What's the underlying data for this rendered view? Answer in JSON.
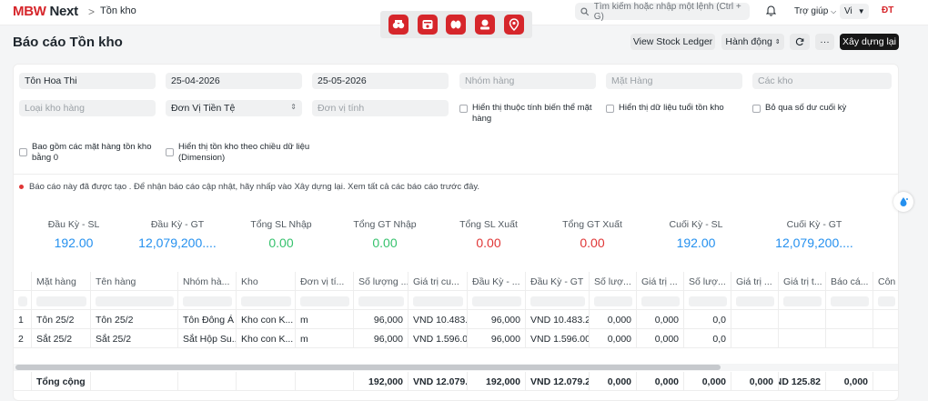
{
  "header": {
    "logo_a": "MBW",
    "logo_b": " Next",
    "breadcrumb_sep": ">",
    "breadcrumb": "Tồn kho",
    "search_placeholder": "Tìm kiếm hoặc nhập một lệnh (Ctrl + G)",
    "help": "Trợ giúp",
    "lang": "Vi",
    "avatar": "ĐT"
  },
  "page": {
    "title": "Báo cáo Tồn kho",
    "view_ledger": "View Stock Ledger",
    "actions": "Hành động",
    "more": "···",
    "rebuild": "Xây dựng lại"
  },
  "filters": {
    "company": "Tôn Hoa Thi",
    "from_date": "25-04-2026",
    "to_date": "25-05-2026",
    "item_group_ph": "Nhóm hàng",
    "item_ph": "Mặt Hàng",
    "warehouse_ph": "Các kho",
    "warehouse_type_ph": "Loại kho hàng",
    "currency": "Đơn Vị Tiền Tệ",
    "uom_ph": "Đơn vị tính",
    "chk_variant": "Hiển thị thuộc tính biến thể mặt hàng",
    "chk_aging": "Hiển thị dữ liệu tuổi tồn kho",
    "chk_skip": "Bỏ qua số dư cuối kỳ",
    "chk_zero": "Bao gồm các mặt hàng tồn kho bằng 0",
    "chk_dimension": "Hiển thị tồn kho theo chiều dữ liệu (Dimension)"
  },
  "notice": "Báo cáo này đã được tạo . Để nhận báo cáo cập nhật, hãy nhấp vào Xây dựng lại. Xem tất cả các báo cáo trước đây.",
  "summary": [
    {
      "label": "Đầu Kỳ - SL",
      "value": "192.00",
      "color": "#2490ef"
    },
    {
      "label": "Đầu Kỳ - GT",
      "value": "12,079,200....",
      "color": "#2490ef"
    },
    {
      "label": "Tổng SL Nhập",
      "value": "0.00",
      "color": "#36c26d"
    },
    {
      "label": "Tổng GT Nhập",
      "value": "0.00",
      "color": "#36c26d"
    },
    {
      "label": "Tổng SL Xuất",
      "value": "0.00",
      "color": "#e03636"
    },
    {
      "label": "Tổng GT Xuất",
      "value": "0.00",
      "color": "#e03636"
    },
    {
      "label": "Cuối Kỳ - SL",
      "value": "192.00",
      "color": "#2490ef"
    },
    {
      "label": "Cuối Kỳ - GT",
      "value": "12,079,200....",
      "color": "#2490ef"
    }
  ],
  "table": {
    "columns": [
      "Mặt hàng",
      "Tên hàng",
      "Nhóm hà...",
      "Kho",
      "Đơn vị tí...",
      "Số lượng ...",
      "Giá trị cu...",
      "Đầu Kỳ - ...",
      "Đầu Kỳ - GT",
      "Số lượ...",
      "Giá trị ...",
      "Số lượ...",
      "Giá trị ...",
      "Giá trị t...",
      "Báo cá...",
      "Côn"
    ],
    "rows": [
      [
        "1",
        "Tôn 25/2",
        "Tôn 25/2",
        "Tôn Đông Á",
        "Kho con K...",
        "m",
        "96,000",
        "VND 10.483.2",
        "96,000",
        "VND 10.483.20",
        "0,000",
        "0,000",
        "0,0",
        "",
        "",
        "",
        ""
      ],
      [
        "2",
        "Sắt 25/2",
        "Sắt 25/2",
        "Sắt Hộp Su...",
        "Kho con K...",
        "m",
        "96,000",
        "VND 1.596.00",
        "96,000",
        "VND 1.596.000",
        "0,000",
        "0,000",
        "0,0",
        "",
        "",
        "",
        ""
      ]
    ],
    "total": [
      "",
      "Tổng cộng",
      "",
      "",
      "",
      "",
      "192,000",
      "VND 12.079.2",
      "192,000",
      "VND 12.079.20",
      "0,000",
      "0,000",
      "0,000",
      "0,000",
      "VND 125.82",
      "0,000",
      ""
    ]
  }
}
